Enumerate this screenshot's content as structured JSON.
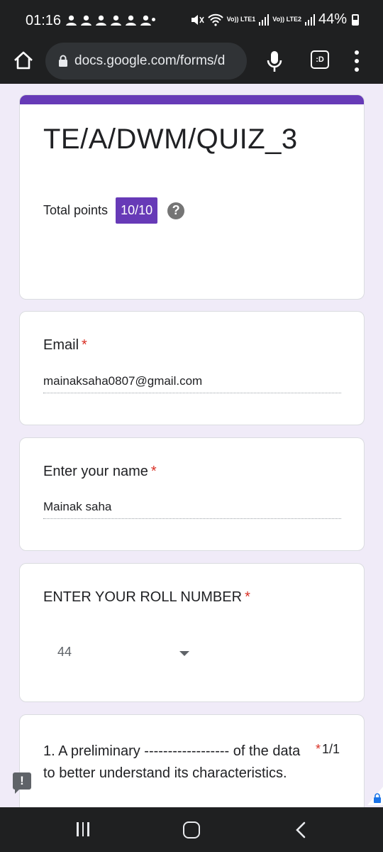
{
  "status_bar": {
    "time": "01:16",
    "network_1": "Vo)) LTE1",
    "network_2": "Vo)) LTE2",
    "battery": "44%"
  },
  "browser": {
    "url": "docs.google.com/forms/d",
    "tab_icon_label": ":D"
  },
  "form": {
    "title": "TE/A/DWM/QUIZ_3",
    "total_points_label": "Total points",
    "total_points_value": "10/10",
    "help_symbol": "?",
    "accent_color": "#673ab7"
  },
  "questions": {
    "email": {
      "label": "Email",
      "required_mark": "*",
      "value": "mainaksaha0807@gmail.com"
    },
    "name": {
      "label": "Enter your name",
      "required_mark": "*",
      "value": "Mainak saha"
    },
    "roll": {
      "label": "ENTER YOUR ROLL NUMBER",
      "required_mark": "*",
      "value": "44"
    },
    "q1": {
      "text": "1. A preliminary ------------------ of the data to better understand its characteristics.",
      "required_mark": "*",
      "score": "1/1"
    }
  },
  "feedback_symbol": "!"
}
